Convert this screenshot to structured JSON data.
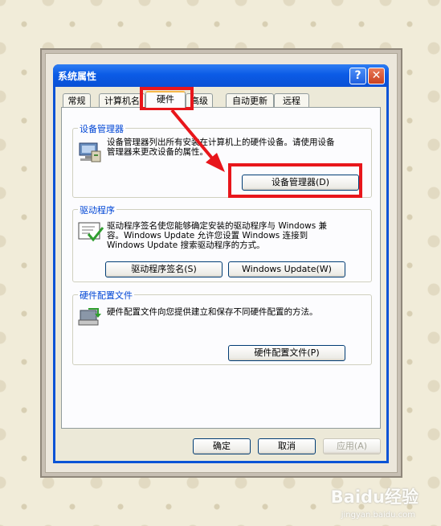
{
  "window": {
    "title": "系统属性"
  },
  "title_buttons": {
    "help": "?",
    "close": "✕"
  },
  "tabs": [
    "常规",
    "计算机名",
    "硬件",
    "高级",
    "自动更新",
    "远程"
  ],
  "device_manager": {
    "legend": "设备管理器",
    "description": "设备管理器列出所有安装在计算机上的硬件设备。请使用设备管理器来更改设备的属性。",
    "button": "设备管理器(D)"
  },
  "drivers": {
    "legend": "驱动程序",
    "description": "驱动程序签名使您能够确定安装的驱动程序与 Windows 兼容。Windows Update 允许您设置 Windows 连接到 Windows Update 搜索驱动程序的方式。",
    "signing_button": "驱动程序签名(S)",
    "update_button": "Windows Update(W)"
  },
  "hardware_profiles": {
    "legend": "硬件配置文件",
    "description": "硬件配置文件向您提供建立和保存不同硬件配置的方法。",
    "button": "硬件配置文件(P)"
  },
  "footer": {
    "ok": "确定",
    "cancel": "取消",
    "apply": "应用(A)"
  },
  "watermark": {
    "brand": "Baidu经验",
    "url": "jingyan.baidu.com"
  },
  "colors": {
    "annotation": "#e8161b",
    "titlebar": "#0a53d6",
    "group_label": "#0046d5"
  }
}
